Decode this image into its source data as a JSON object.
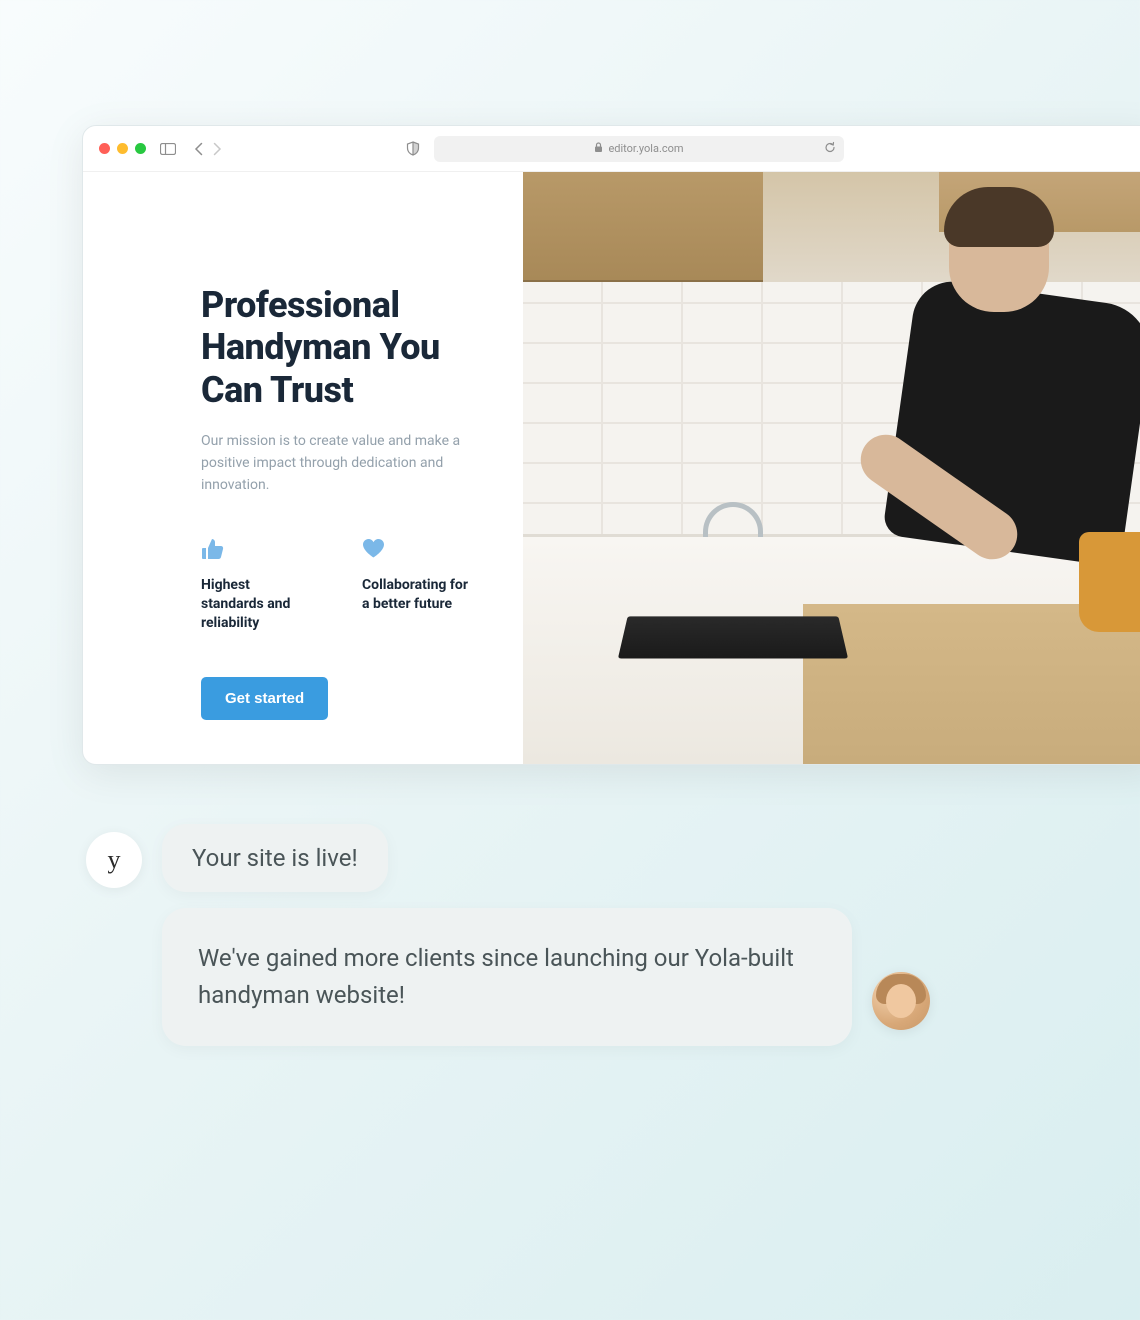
{
  "browser": {
    "url": "editor.yola.com"
  },
  "hero": {
    "title": "Professional Handyman You Can Trust",
    "subtitle": "Our mission is to create value and make a positive impact through dedication and innovation.",
    "cta_label": "Get started"
  },
  "features": [
    {
      "text": "Highest standards and reliability"
    },
    {
      "text": "Collaborating for a better future"
    }
  ],
  "chat": {
    "system_avatar": "y",
    "message1": "Your site is live!",
    "message2": "We've gained more clients since launching our Yola-built handyman website!"
  },
  "colors": {
    "primary_button": "#3a9ce0",
    "feature_icon": "#7bb8e8",
    "heading": "#1a2838",
    "body_text": "#93a0ab"
  }
}
